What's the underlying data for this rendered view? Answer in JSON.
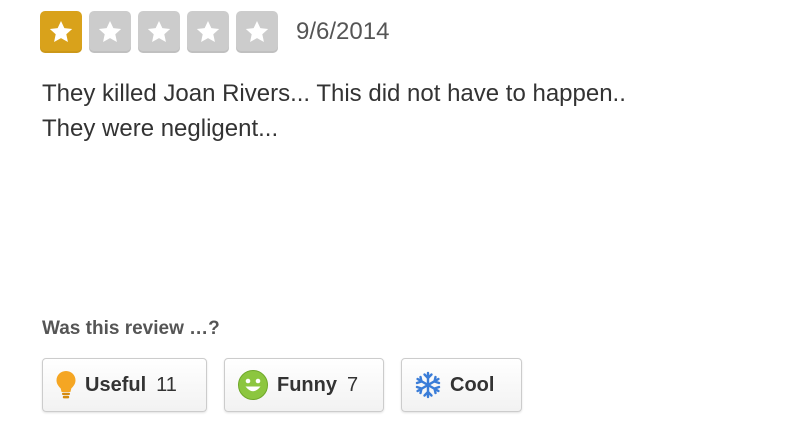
{
  "review": {
    "rating": 1,
    "rating_max": 5,
    "date": "9/6/2014",
    "text_lines": [
      "They killed Joan Rivers... This did not have to happen..",
      "They were negligent..."
    ]
  },
  "votes": {
    "question": "Was this review …?",
    "useful": {
      "label": "Useful",
      "count": "11",
      "icon": "lightbulb-icon"
    },
    "funny": {
      "label": "Funny",
      "count": "7",
      "icon": "smiley-face-icon"
    },
    "cool": {
      "label": "Cool",
      "icon": "snowflake-icon"
    }
  },
  "colors": {
    "star_active": "#d9a21b",
    "star_inactive": "#cccccc",
    "useful_icon": "#f5a623",
    "funny_icon": "#8cc63f",
    "cool_icon": "#3b7dd8"
  }
}
